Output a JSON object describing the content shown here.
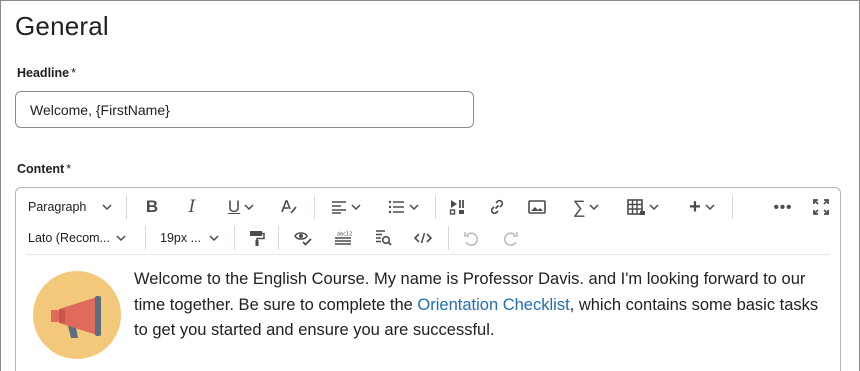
{
  "section": {
    "title": "General"
  },
  "headline": {
    "label": "Headline",
    "required_mark": "*",
    "value": "Welcome, {FirstName}"
  },
  "content": {
    "label": "Content",
    "required_mark": "*"
  },
  "toolbar": {
    "block_format": "Paragraph",
    "font_family": "Lato (Recom...",
    "font_size": "19px ...",
    "icons": [
      "bold-icon",
      "italic-icon",
      "underline-icon",
      "clear-format-icon",
      "align-icon",
      "list-icon",
      "media-icon",
      "link-icon",
      "image-icon",
      "equation-icon",
      "table-icon",
      "insert-icon",
      "more-icon",
      "fullscreen-icon",
      "format-painter-icon",
      "accessibility-check-icon",
      "word-count-icon",
      "find-replace-icon",
      "source-code-icon",
      "undo-icon",
      "redo-icon"
    ]
  },
  "editor_body": {
    "text_before_link": "Welcome to the English Course. My name is Professor Davis. and I'm looking forward to our time together. Be sure to complete the ",
    "link_text": "Orientation Checklist",
    "text_after_link": ", which contains some basic tasks to get you started and ensure you are successful."
  },
  "colors": {
    "link": "#1f6fb2",
    "megaphone_bg": "#f4c87a",
    "megaphone_body": "#e06a5b",
    "megaphone_handle": "#5a6f80"
  }
}
